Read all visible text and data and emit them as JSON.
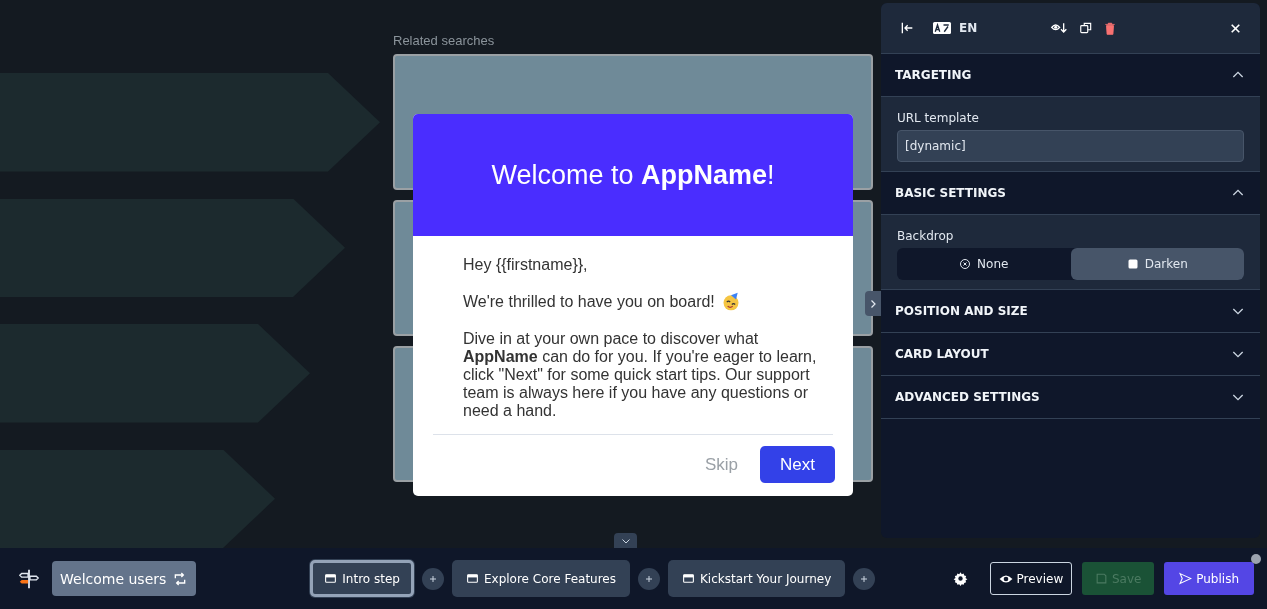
{
  "canvas": {
    "label": "Related searches"
  },
  "modal": {
    "title": "Welcome to **AppName**!",
    "greeting": "Hey {{firstname}},",
    "intro": "We're thrilled to have you on board!",
    "body": "Dive in at your own pace to discover what **AppName** can do for you. If you're eager to learn, click \"Next\" for some quick start tips. Our support team is always here if you have any questions or need a hand.",
    "buttons": [
      {
        "label": "Skip",
        "kind": "secondary"
      },
      {
        "label": "Next",
        "kind": "primary"
      }
    ]
  },
  "panel": {
    "language": "EN",
    "sections": [
      {
        "title": "TARGETING",
        "expanded": true,
        "kind": "field",
        "label": "URL template",
        "value": "[dynamic]"
      },
      {
        "title": "BASIC SETTINGS",
        "expanded": true,
        "kind": "choice",
        "label": "Backdrop",
        "options": [
          {
            "label": "None",
            "selected": false
          },
          {
            "label": "Darken",
            "selected": true
          }
        ]
      },
      {
        "title": "POSITION AND SIZE",
        "expanded": false
      },
      {
        "title": "CARD LAYOUT",
        "expanded": false
      },
      {
        "title": "ADVANCED SETTINGS",
        "expanded": false
      }
    ]
  },
  "bottom_bar": {
    "flow": "Welcome users",
    "steps": [
      {
        "label": "Intro step",
        "selected": true
      },
      {
        "label": "Explore Core Features",
        "selected": false
      },
      {
        "label": "Kickstart Your Journey",
        "selected": false
      }
    ],
    "actions": [
      {
        "label": "Preview",
        "kind": "outline"
      },
      {
        "label": "Save",
        "kind": "save"
      },
      {
        "label": "Publish",
        "kind": "primary"
      }
    ]
  }
}
